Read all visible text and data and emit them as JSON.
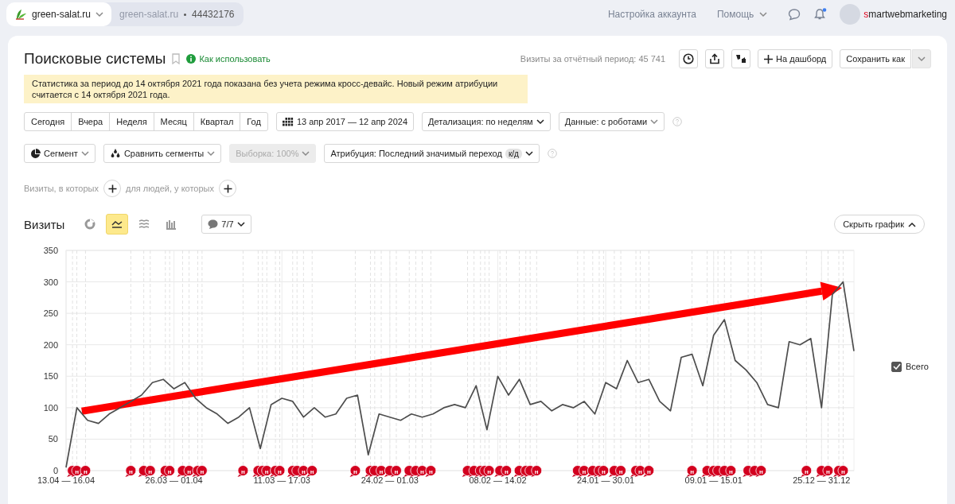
{
  "top_bar": {
    "site": "green-salat.ru",
    "counter_site": "green-salat.ru",
    "counter_id": "44432176",
    "links": [
      {
        "label": "Настройка аккаунта",
        "kind": "link"
      },
      {
        "label": "Помощь",
        "kind": "menu"
      }
    ],
    "notifications_unread": true,
    "user": "smartwebmarketing"
  },
  "report": {
    "title": "Поисковые системы",
    "help_link": "Как использовать",
    "visits_total": "Визиты за отчётный период: 45 741",
    "to_dashboard": "На дашборд",
    "save_as": "Сохранить как",
    "notice": "Статистика за период до 14 октября 2021 года показана без учета режима кросс-девайс. Новый режим атрибуции считается с 14 октября 2021 года.",
    "periods": [
      "Сегодня",
      "Вчера",
      "Неделя",
      "Месяц",
      "Квартал",
      "Год"
    ],
    "date_range": "13 апр 2017 — 12 апр 2024",
    "detail": "Детализация: по неделям",
    "data_filter": "Данные: с роботами",
    "segment": "Сегмент",
    "compare": "Сравнить сегменты",
    "sample": {
      "label": "Выборка: 100%",
      "disabled": true
    },
    "attribution": "Атрибуция: Последний значимый переход",
    "attribution_badge": "к/д",
    "filter_visits": "Визиты, в которых",
    "filter_people": "для людей, у которых"
  },
  "chart": {
    "title": "Визиты",
    "chart_types": [
      {
        "kind": "pie",
        "selected": false
      },
      {
        "kind": "line",
        "selected": true
      },
      {
        "kind": "stacked",
        "selected": false
      },
      {
        "kind": "bars",
        "selected": false
      }
    ],
    "notes_filter": "7/7",
    "hide_button": "Скрыть график",
    "legend_checked": true,
    "trend_arrow": {
      "color": "#ff0000"
    },
    "notes": [
      {
        "kind": "note"
      },
      {
        "kind": "note",
        "text": "н"
      },
      {
        "kind": "note",
        "text": "н"
      },
      {
        "kind": "note",
        "text": "н"
      },
      {
        "kind": "note"
      },
      {
        "kind": "note",
        "text": "н"
      },
      {
        "kind": "note"
      },
      {
        "kind": "note",
        "text": "н"
      },
      {
        "kind": "note"
      },
      {
        "kind": "note",
        "text": "н"
      },
      {
        "kind": "note"
      },
      {
        "kind": "note",
        "text": "н"
      },
      {
        "kind": "note",
        "text": "н"
      },
      {
        "kind": "note"
      },
      {
        "kind": "note"
      },
      {
        "kind": "note",
        "text": "н"
      },
      {
        "kind": "note"
      },
      {
        "kind": "note",
        "text": "н"
      },
      {
        "kind": "note"
      },
      {
        "kind": "note"
      },
      {
        "kind": "note",
        "text": "н"
      },
      {
        "kind": "note",
        "text": "н"
      },
      {
        "kind": "note",
        "text": "н"
      },
      {
        "kind": "note"
      },
      {
        "kind": "note"
      },
      {
        "kind": "note",
        "text": "н"
      },
      {
        "kind": "note"
      },
      {
        "kind": "note",
        "text": "н"
      },
      {
        "kind": "note"
      },
      {
        "kind": "note"
      },
      {
        "kind": "note",
        "text": "н"
      },
      {
        "kind": "note",
        "text": "н"
      },
      {
        "kind": "note"
      },
      {
        "kind": "note"
      },
      {
        "kind": "note"
      },
      {
        "kind": "note"
      },
      {
        "kind": "note",
        "text": "н"
      },
      {
        "kind": "note"
      },
      {
        "kind": "note",
        "text": "н"
      },
      {
        "kind": "note"
      },
      {
        "kind": "note"
      },
      {
        "kind": "note"
      },
      {
        "kind": "note",
        "text": "н"
      },
      {
        "kind": "note"
      },
      {
        "kind": "note",
        "text": "н"
      },
      {
        "kind": "note"
      },
      {
        "kind": "note"
      },
      {
        "kind": "note",
        "text": "н"
      },
      {
        "kind": "note"
      },
      {
        "kind": "note",
        "text": "н"
      },
      {
        "kind": "note"
      },
      {
        "kind": "note",
        "text": "н"
      },
      {
        "kind": "note",
        "text": "н"
      },
      {
        "kind": "note",
        "text": "н"
      },
      {
        "kind": "note"
      },
      {
        "kind": "note"
      },
      {
        "kind": "note"
      },
      {
        "kind": "note"
      },
      {
        "kind": "note",
        "text": "н"
      },
      {
        "kind": "note"
      },
      {
        "kind": "note"
      },
      {
        "kind": "note",
        "text": "н"
      },
      {
        "kind": "note",
        "text": "н"
      },
      {
        "kind": "note"
      },
      {
        "kind": "note",
        "text": "н"
      },
      {
        "kind": "note"
      },
      {
        "kind": "note",
        "text": "н"
      }
    ],
    "chart_data": {
      "type": "line",
      "categories": [
        "13.04 — 16.04",
        null,
        null,
        null,
        null,
        null,
        null,
        null,
        null,
        null,
        "26.03 — 01.04",
        null,
        null,
        null,
        null,
        null,
        null,
        null,
        null,
        null,
        "11.03 — 17.03",
        null,
        null,
        null,
        null,
        null,
        null,
        null,
        null,
        null,
        "24.02 — 01.03",
        null,
        null,
        null,
        null,
        null,
        null,
        null,
        null,
        null,
        "08.02 — 14.02",
        null,
        null,
        null,
        null,
        null,
        null,
        null,
        null,
        null,
        "24.01 — 30.01",
        null,
        null,
        null,
        null,
        null,
        null,
        null,
        null,
        null,
        "09.01 — 15.01",
        null,
        null,
        null,
        null,
        null,
        null,
        null,
        null,
        null,
        "25.12 — 31.12",
        null,
        null,
        null
      ],
      "series": [
        {
          "name": "Всего",
          "color": "#4d4d4d",
          "values": [
            5,
            100,
            80,
            75,
            90,
            100,
            110,
            120,
            140,
            145,
            130,
            140,
            115,
            100,
            90,
            75,
            85,
            100,
            35,
            105,
            115,
            110,
            85,
            100,
            85,
            90,
            115,
            120,
            25,
            90,
            85,
            80,
            90,
            85,
            90,
            100,
            105,
            100,
            135,
            65,
            150,
            120,
            145,
            105,
            110,
            95,
            105,
            100,
            110,
            90,
            140,
            130,
            175,
            140,
            145,
            110,
            95,
            180,
            185,
            135,
            215,
            240,
            175,
            160,
            140,
            105,
            100,
            205,
            200,
            210,
            100,
            280,
            300,
            190
          ]
        }
      ],
      "ylim": [
        0,
        350
      ],
      "yticks": [
        0,
        50,
        100,
        150,
        200,
        250,
        300,
        350
      ],
      "grid": true
    }
  }
}
